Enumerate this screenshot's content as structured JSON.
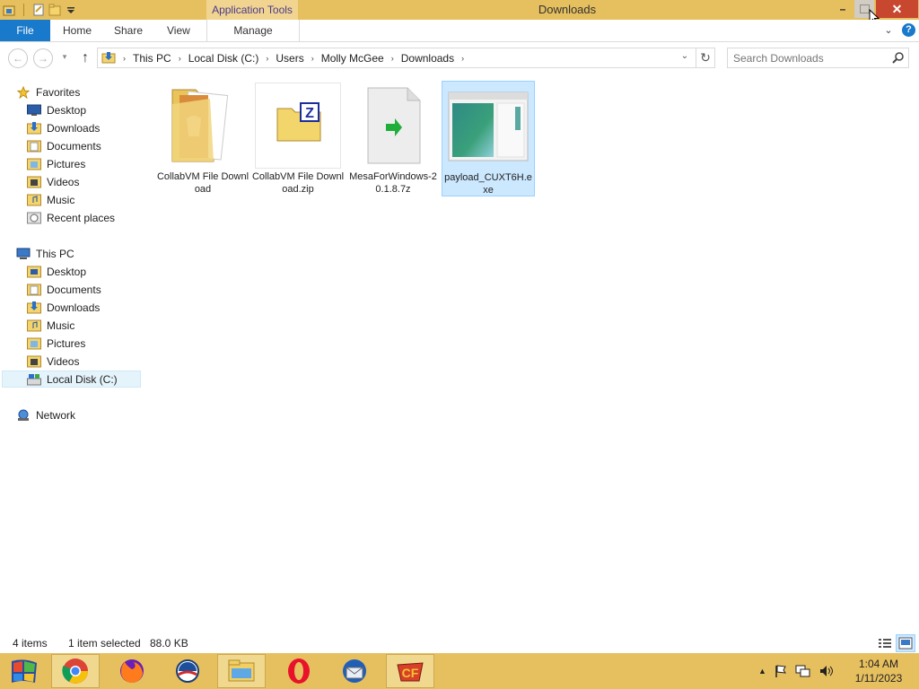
{
  "window": {
    "title": "Downloads",
    "context_tab": "Application Tools"
  },
  "ribbon": {
    "tabs": [
      "File",
      "Home",
      "Share",
      "View",
      "Manage"
    ]
  },
  "address": {
    "crumbs": [
      "This PC",
      "Local Disk (C:)",
      "Users",
      "Molly McGee",
      "Downloads"
    ]
  },
  "search": {
    "placeholder": "Search Downloads"
  },
  "nav": {
    "favorites_label": "Favorites",
    "favorites": [
      "Desktop",
      "Downloads",
      "Documents",
      "Pictures",
      "Videos",
      "Music",
      "Recent places"
    ],
    "thispc_label": "This PC",
    "thispc": [
      "Desktop",
      "Documents",
      "Downloads",
      "Music",
      "Pictures",
      "Videos",
      "Local Disk (C:)"
    ],
    "network_label": "Network",
    "selected": "Local Disk (C:)"
  },
  "files": [
    {
      "name": "CollabVM File Download",
      "type": "folder"
    },
    {
      "name": "CollabVM File Download.zip",
      "type": "zip"
    },
    {
      "name": "MesaForWindows-20.1.8.7z",
      "type": "7z"
    },
    {
      "name": "payload_CUXT6H.exe",
      "type": "exe",
      "selected": true
    }
  ],
  "status": {
    "count": "4 items",
    "selection": "1 item selected",
    "size": "88.0 KB"
  },
  "taskbar": {
    "apps": [
      "start-icon",
      "chrome-icon",
      "firefox-icon",
      "ie-icon",
      "file-explorer-icon",
      "opera-icon",
      "thunderbird-icon",
      "game-icon"
    ],
    "active": "file-explorer-icon",
    "clock_time": "1:04 AM",
    "clock_date": "1/11/2023"
  },
  "colors": {
    "titlebar": "#e6bf5f",
    "file_tab": "#1979ca",
    "selection": "#cce8ff",
    "close_button": "#c7472f"
  }
}
